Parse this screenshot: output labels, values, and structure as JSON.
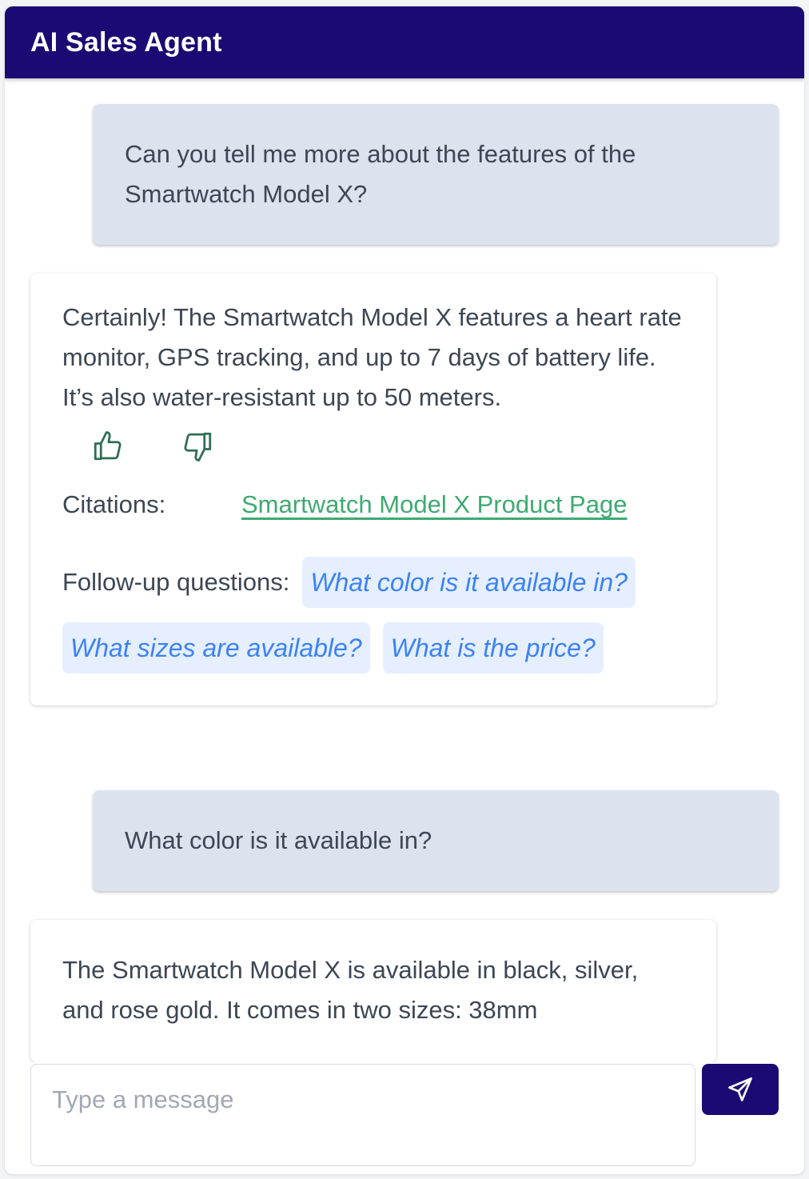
{
  "header": {
    "title": "AI Sales Agent"
  },
  "messages": [
    {
      "role": "user",
      "text": "Can you tell me more about the features of the Smartwatch Model X?"
    },
    {
      "role": "assistant",
      "text": "Certainly! The Smartwatch Model X features a heart rate monitor, GPS tracking, and up to 7 days of battery life. It’s also water-resistant up to 50 meters.",
      "citations_label": "Citations:",
      "citation_link": "Smartwatch Model X Product Page",
      "followups_label": "Follow-up questions:",
      "followups": [
        "What color is it available in?",
        "What sizes are available?",
        "What is the price?"
      ]
    },
    {
      "role": "user",
      "text": "What color is it available in?"
    },
    {
      "role": "assistant",
      "text": "The Smartwatch Model X is available in black, silver, and rose gold. It comes in two sizes: 38mm"
    }
  ],
  "icons": {
    "like": "thumbs-up-icon",
    "dislike": "thumbs-down-icon",
    "send": "send-icon"
  },
  "composer": {
    "placeholder": "Type a message"
  },
  "colors": {
    "brand": "#1b0a73",
    "user_bubble": "#dde3ee",
    "link": "#3eaa70",
    "chip_bg": "#e6efff",
    "chip_text": "#3b82f6",
    "feedback_icon": "#2f6f54"
  }
}
